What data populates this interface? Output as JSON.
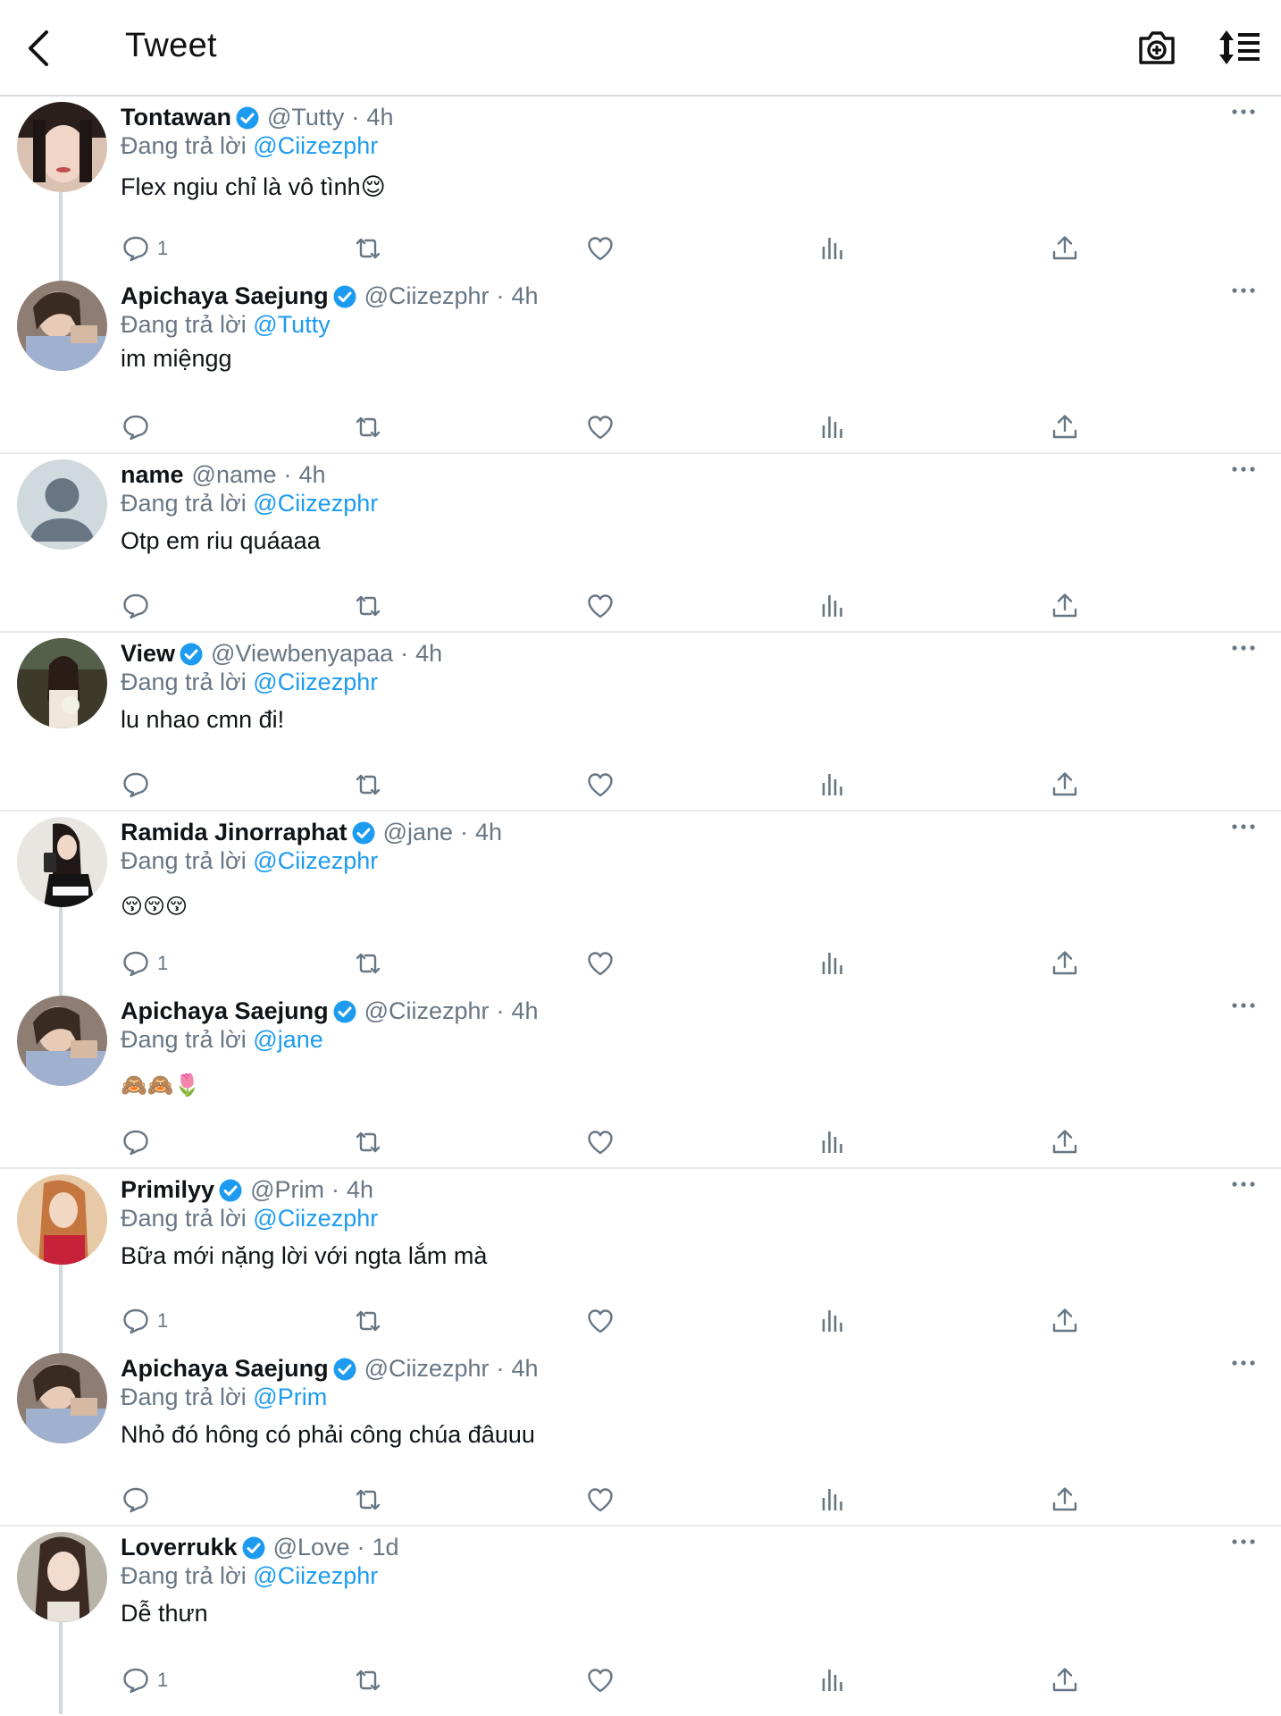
{
  "header": {
    "title": "Tweet",
    "back_icon": "chevron-left-icon",
    "camera_icon": "camera-plus-icon",
    "sort_icon": "sort-list-icon"
  },
  "colors": {
    "link": "#1d9bf0",
    "secondary_text": "#687684",
    "primary_text": "#0f1419",
    "divider": "#e7e9eb",
    "thread_line": "#cfd9de"
  },
  "replying_prefix": "Đang trả lời",
  "tweets": [
    {
      "name": "Tontawan",
      "verified": true,
      "handle": "@Tutty",
      "dot": "·",
      "time": "4h",
      "reply_to": "@Ciizezphr",
      "text": "Flex ngiu chỉ là vô tình😌",
      "reply_count": "1"
    },
    {
      "name": "Apichaya Saejung",
      "verified": true,
      "handle": "@Ciizezphr",
      "dot": "·",
      "time": "4h",
      "reply_to": "@Tutty",
      "text": "im miệngg",
      "reply_count": ""
    },
    {
      "name": "name",
      "verified": false,
      "handle": "@name",
      "dot": "·",
      "time": "4h",
      "reply_to": "@Ciizezphr",
      "text": "Otp em riu quáaaa",
      "reply_count": ""
    },
    {
      "name": "View",
      "verified": true,
      "handle": "@Viewbenyapaa",
      "dot": "·",
      "time": "4h",
      "reply_to": "@Ciizezphr",
      "text": "lu nhao cmn đi!",
      "reply_count": ""
    },
    {
      "name": "Ramida Jinorraphat",
      "verified": true,
      "handle": "@jane",
      "dot": "·",
      "time": "4h",
      "reply_to": "@Ciizezphr",
      "text": "😚😚😚",
      "reply_count": "1"
    },
    {
      "name": "Apichaya Saejung",
      "verified": true,
      "handle": "@Ciizezphr",
      "dot": "·",
      "time": "4h",
      "reply_to": "@jane",
      "text": "🙈🙈🌷",
      "reply_count": ""
    },
    {
      "name": "Primilyy",
      "verified": true,
      "handle": "@Prim",
      "dot": "·",
      "time": "4h",
      "reply_to": "@Ciizezphr",
      "text": "Bữa mới nặng lời với ngta lắm mà",
      "reply_count": "1"
    },
    {
      "name": "Apichaya Saejung",
      "verified": true,
      "handle": "@Ciizezphr",
      "dot": "·",
      "time": "4h",
      "reply_to": "@Prim",
      "text": "Nhỏ đó hông có phải công chúa đâuuu",
      "reply_count": ""
    },
    {
      "name": "Loverrukk",
      "verified": true,
      "handle": "@Love",
      "dot": "·",
      "time": "1d",
      "reply_to": "@Ciizezphr",
      "text": "Dễ thưn",
      "reply_count": "1"
    }
  ]
}
